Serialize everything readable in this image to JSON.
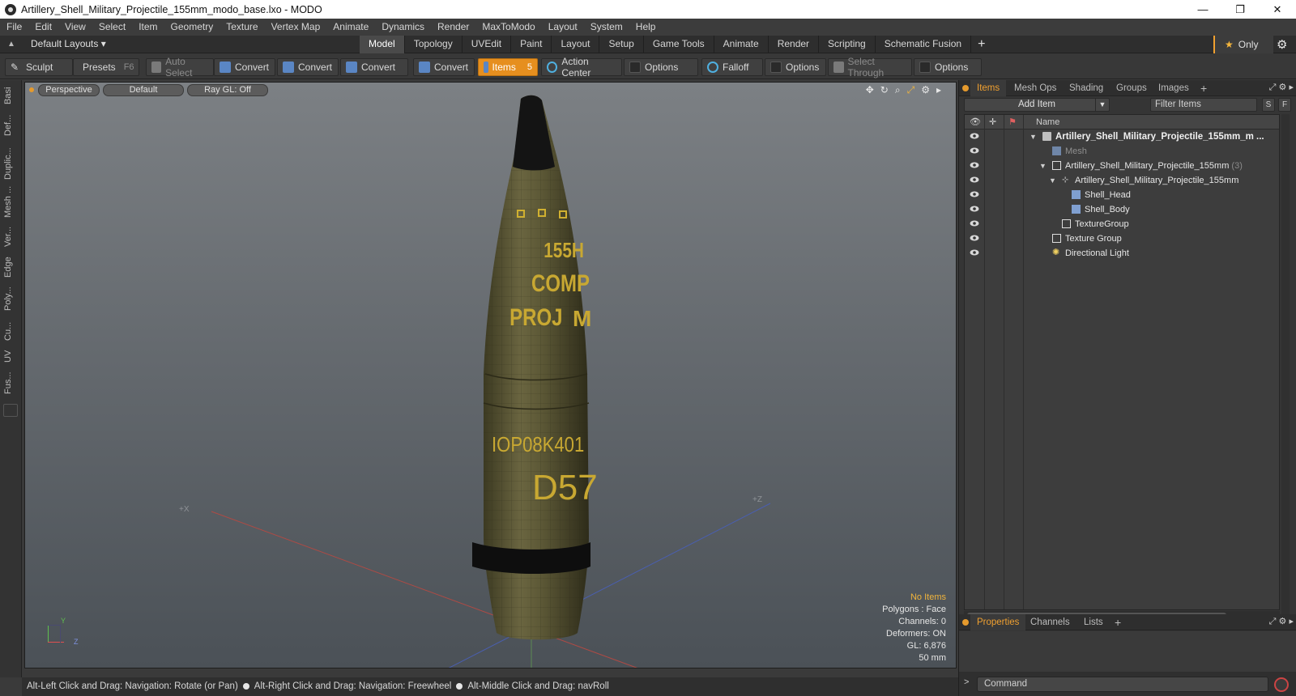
{
  "window": {
    "title": "Artillery_Shell_Military_Projectile_155mm_modo_base.lxo - MODO",
    "minimize": "—",
    "restore": "❐",
    "close": "✕"
  },
  "menu": [
    "File",
    "Edit",
    "View",
    "Select",
    "Item",
    "Geometry",
    "Texture",
    "Vertex Map",
    "Animate",
    "Dynamics",
    "Render",
    "MaxToModo",
    "Layout",
    "System",
    "Help"
  ],
  "layouts": {
    "label": "Default Layouts ▾"
  },
  "tabs": [
    "Model",
    "Topology",
    "UVEdit",
    "Paint",
    "Layout",
    "Setup",
    "Game Tools",
    "Animate",
    "Render",
    "Scripting",
    "Schematic Fusion"
  ],
  "active_tab": "Model",
  "tab_plus": "+",
  "only": {
    "label": "Only",
    "star": "★"
  },
  "toolbar": {
    "sculpt": "Sculpt",
    "presets": "Presets",
    "presets_key": "F6",
    "auto_select": "Auto Select",
    "convert1": "Convert",
    "convert2": "Convert",
    "convert3": "Convert",
    "convert4": "Convert",
    "items": "Items",
    "items_key": "5",
    "action_center": "Action Center",
    "options1": "Options",
    "falloff": "Falloff",
    "options2": "Options",
    "select_through": "Select Through",
    "options3": "Options"
  },
  "left_tabs": [
    "Basi",
    "Def...",
    "Duplic...",
    "Mesh ...",
    "Ver...",
    "Edge",
    "Poly...",
    "Cu...",
    "UV",
    "Fus..."
  ],
  "viewport": {
    "view": "Perspective",
    "shading": "Default",
    "raygl": "Ray GL: Off",
    "axis_x": "+X",
    "axis_z": "+Z",
    "gizmo_y": "Y",
    "gizmo_z": "Z",
    "shell_text": [
      "155H",
      "COMP",
      "PROJ",
      "M",
      "IOP08K401",
      "D57"
    ],
    "stats": {
      "no_items": "No Items",
      "polygons": "Polygons : Face",
      "channels": "Channels: 0",
      "deformers": "Deformers: ON",
      "gl": "GL: 6,876",
      "focal": "50 mm"
    }
  },
  "statusbar": {
    "hint1": "Alt-Left Click and Drag: Navigation: Rotate (or Pan)",
    "hint2": "Alt-Right Click and Drag: Navigation: Freewheel",
    "hint3": "Alt-Middle Click and Drag: navRoll"
  },
  "items_panel": {
    "tabs": [
      "Items",
      "Mesh Ops",
      "Shading",
      "Groups",
      "Images"
    ],
    "add_item": "Add Item",
    "filter_placeholder": "Filter Items",
    "s_btn": "S",
    "f_btn": "F",
    "col_name": "Name",
    "rows": [
      {
        "label": "Artillery_Shell_Military_Projectile_155mm_m ...",
        "style": "bold",
        "icon": "scene"
      },
      {
        "label": "Mesh",
        "style": "dim",
        "icon": "mesh"
      },
      {
        "label": "Artillery_Shell_Military_Projectile_155mm",
        "count": "(3)",
        "style": "normal",
        "icon": "group"
      },
      {
        "label": "Artillery_Shell_Military_Projectile_155mm",
        "style": "normal",
        "icon": "locator"
      },
      {
        "label": "Shell_Head",
        "style": "normal",
        "icon": "mesh"
      },
      {
        "label": "Shell_Body",
        "style": "normal",
        "icon": "mesh"
      },
      {
        "label": "TextureGroup",
        "style": "normal",
        "icon": "group"
      },
      {
        "label": "Texture Group",
        "style": "normal",
        "icon": "group"
      },
      {
        "label": "Directional Light",
        "style": "normal",
        "icon": "light"
      }
    ]
  },
  "props_panel": {
    "tabs": [
      "Properties",
      "Channels",
      "Lists"
    ]
  },
  "command": {
    "placeholder": "Command",
    "prompt": ">"
  },
  "colors": {
    "accent": "#f0a030",
    "shell": "#5e5a36",
    "text_yellow": "#c8a832"
  }
}
